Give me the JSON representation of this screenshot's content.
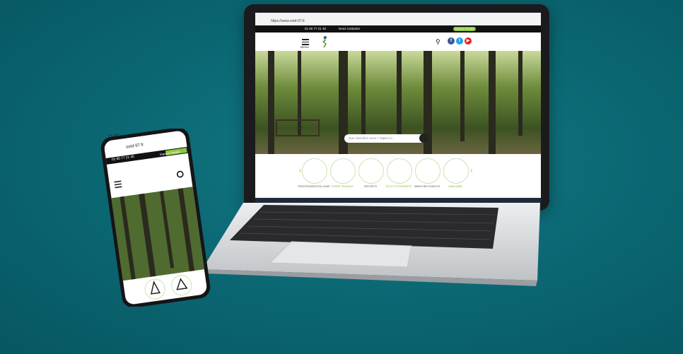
{
  "colors": {
    "background": "#0a6671",
    "accent_green": "#8cc63e",
    "laptop_body": "#1b1b1d",
    "laptop_base": "#d9dadc"
  },
  "laptop": {
    "browser": {
      "url": "https://www.sotd-97.fr"
    },
    "topbar": {
      "phone_text": "01 60 77 21 45",
      "contact_text": "Nous contacter",
      "cta_label": "Espace Famille"
    },
    "nav": {
      "menu_label": "MENU",
      "icons": [
        "search-icon",
        "facebook-icon",
        "twitter-icon",
        "youtube-icon"
      ]
    },
    "hero": {
      "search_placeholder": "Que cherchez-vous ? Tapez ici..."
    },
    "services": [
      {
        "label": "PROCÉDURES EN LIGNE",
        "icon": "document-icon",
        "highlight": false
      },
      {
        "label": "VOIRIE TRAVAUX",
        "icon": "cone-icon",
        "highlight": true
      },
      {
        "label": "DÉCHETS",
        "icon": "recycle-icon",
        "highlight": false
      },
      {
        "label": "ÉCO-CITOYENNETÉ",
        "icon": "hands-plant-icon",
        "highlight": true
      },
      {
        "label": "MARCHÉS PUBLICS",
        "icon": "handshake-icon",
        "highlight": false
      },
      {
        "label": "ANNUAIRE",
        "icon": "book-icon",
        "highlight": true
      }
    ]
  },
  "phone": {
    "status_time": "15:45",
    "url": "sotd-97.fr",
    "topbar": {
      "phone_text": "01 60 77 21 45",
      "cta_label": "Espace Famille"
    }
  }
}
